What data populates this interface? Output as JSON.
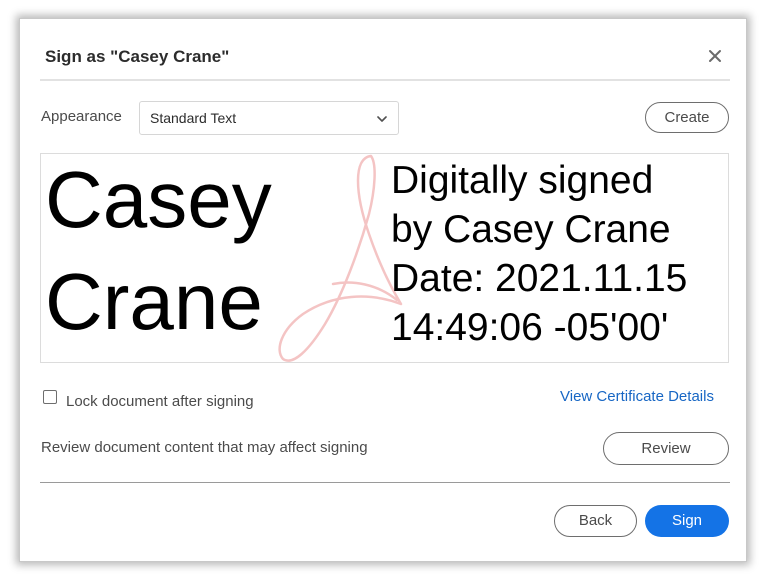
{
  "dialog": {
    "title": "Sign as \"Casey Crane\"",
    "close_icon": "close-icon"
  },
  "appearance": {
    "label": "Appearance",
    "selected": "Standard Text",
    "dropdown_icon": "chevron-down-icon",
    "create_label": "Create"
  },
  "signature_preview": {
    "name_line_1": "Casey",
    "name_line_2": "Crane",
    "detail_lines": [
      "Digitally signed",
      "by Casey Crane",
      "Date: 2021.11.15",
      "14:49:06 -05'00'"
    ],
    "watermark_icon": "acrobat-logo-watermark",
    "watermark_color": "#f2b8b8"
  },
  "options": {
    "lock_label": "Lock document after signing",
    "lock_checked": false,
    "certificate_link": "View Certificate Details"
  },
  "review": {
    "text": "Review document content that may affect signing",
    "button_label": "Review"
  },
  "footer": {
    "back_label": "Back",
    "sign_label": "Sign"
  },
  "colors": {
    "primary": "#1473e6",
    "link": "#1766c4"
  }
}
